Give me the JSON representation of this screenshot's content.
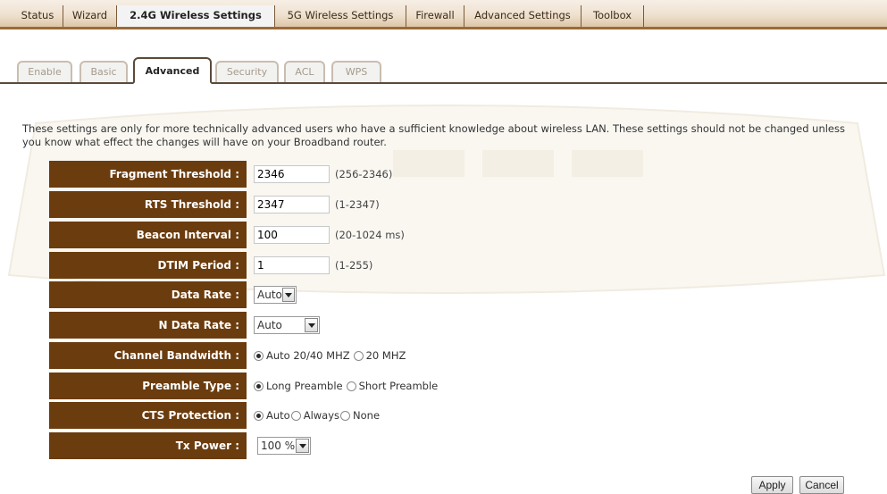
{
  "nav": {
    "items": [
      {
        "label": "Status"
      },
      {
        "label": "Wizard"
      },
      {
        "label": "2.4G Wireless Settings",
        "active": true
      },
      {
        "label": "5G Wireless Settings"
      },
      {
        "label": "Firewall"
      },
      {
        "label": "Advanced Settings"
      },
      {
        "label": "Toolbox"
      }
    ]
  },
  "subtabs": [
    {
      "label": "Enable"
    },
    {
      "label": "Basic"
    },
    {
      "label": "Advanced",
      "active": true
    },
    {
      "label": "Security"
    },
    {
      "label": "ACL"
    },
    {
      "label": "WPS"
    }
  ],
  "description": "These settings are only for more technically advanced users who have a sufficient knowledge about wireless LAN. These settings should not be changed unless you know what effect the changes will have on your Broadband router.",
  "form": {
    "fragment_threshold": {
      "label": "Fragment Threshold :",
      "value": "2346",
      "range": "(256-2346)"
    },
    "rts_threshold": {
      "label": "RTS Threshold :",
      "value": "2347",
      "range": "(1-2347)"
    },
    "beacon_interval": {
      "label": "Beacon Interval :",
      "value": "100",
      "range": "(20-1024 ms)"
    },
    "dtim_period": {
      "label": "DTIM Period :",
      "value": "1",
      "range": "(1-255)"
    },
    "data_rate": {
      "label": "Data Rate :",
      "value": "Auto"
    },
    "n_data_rate": {
      "label": "N Data Rate :",
      "value": "Auto"
    },
    "channel_bandwidth": {
      "label": "Channel Bandwidth :",
      "options": [
        "Auto 20/40 MHZ",
        "20 MHZ"
      ],
      "selected": "Auto 20/40 MHZ"
    },
    "preamble_type": {
      "label": "Preamble Type :",
      "options": [
        "Long Preamble",
        "Short Preamble"
      ],
      "selected": "Long Preamble"
    },
    "cts_protection": {
      "label": "CTS Protection :",
      "options": [
        "Auto",
        "Always",
        "None"
      ],
      "selected": "Auto"
    },
    "tx_power": {
      "label": "Tx Power :",
      "value": "100 %"
    }
  },
  "buttons": {
    "apply": "Apply",
    "cancel": "Cancel"
  },
  "colors": {
    "label_bg": "#6b3c0e",
    "nav_border": "#9a6a38"
  }
}
